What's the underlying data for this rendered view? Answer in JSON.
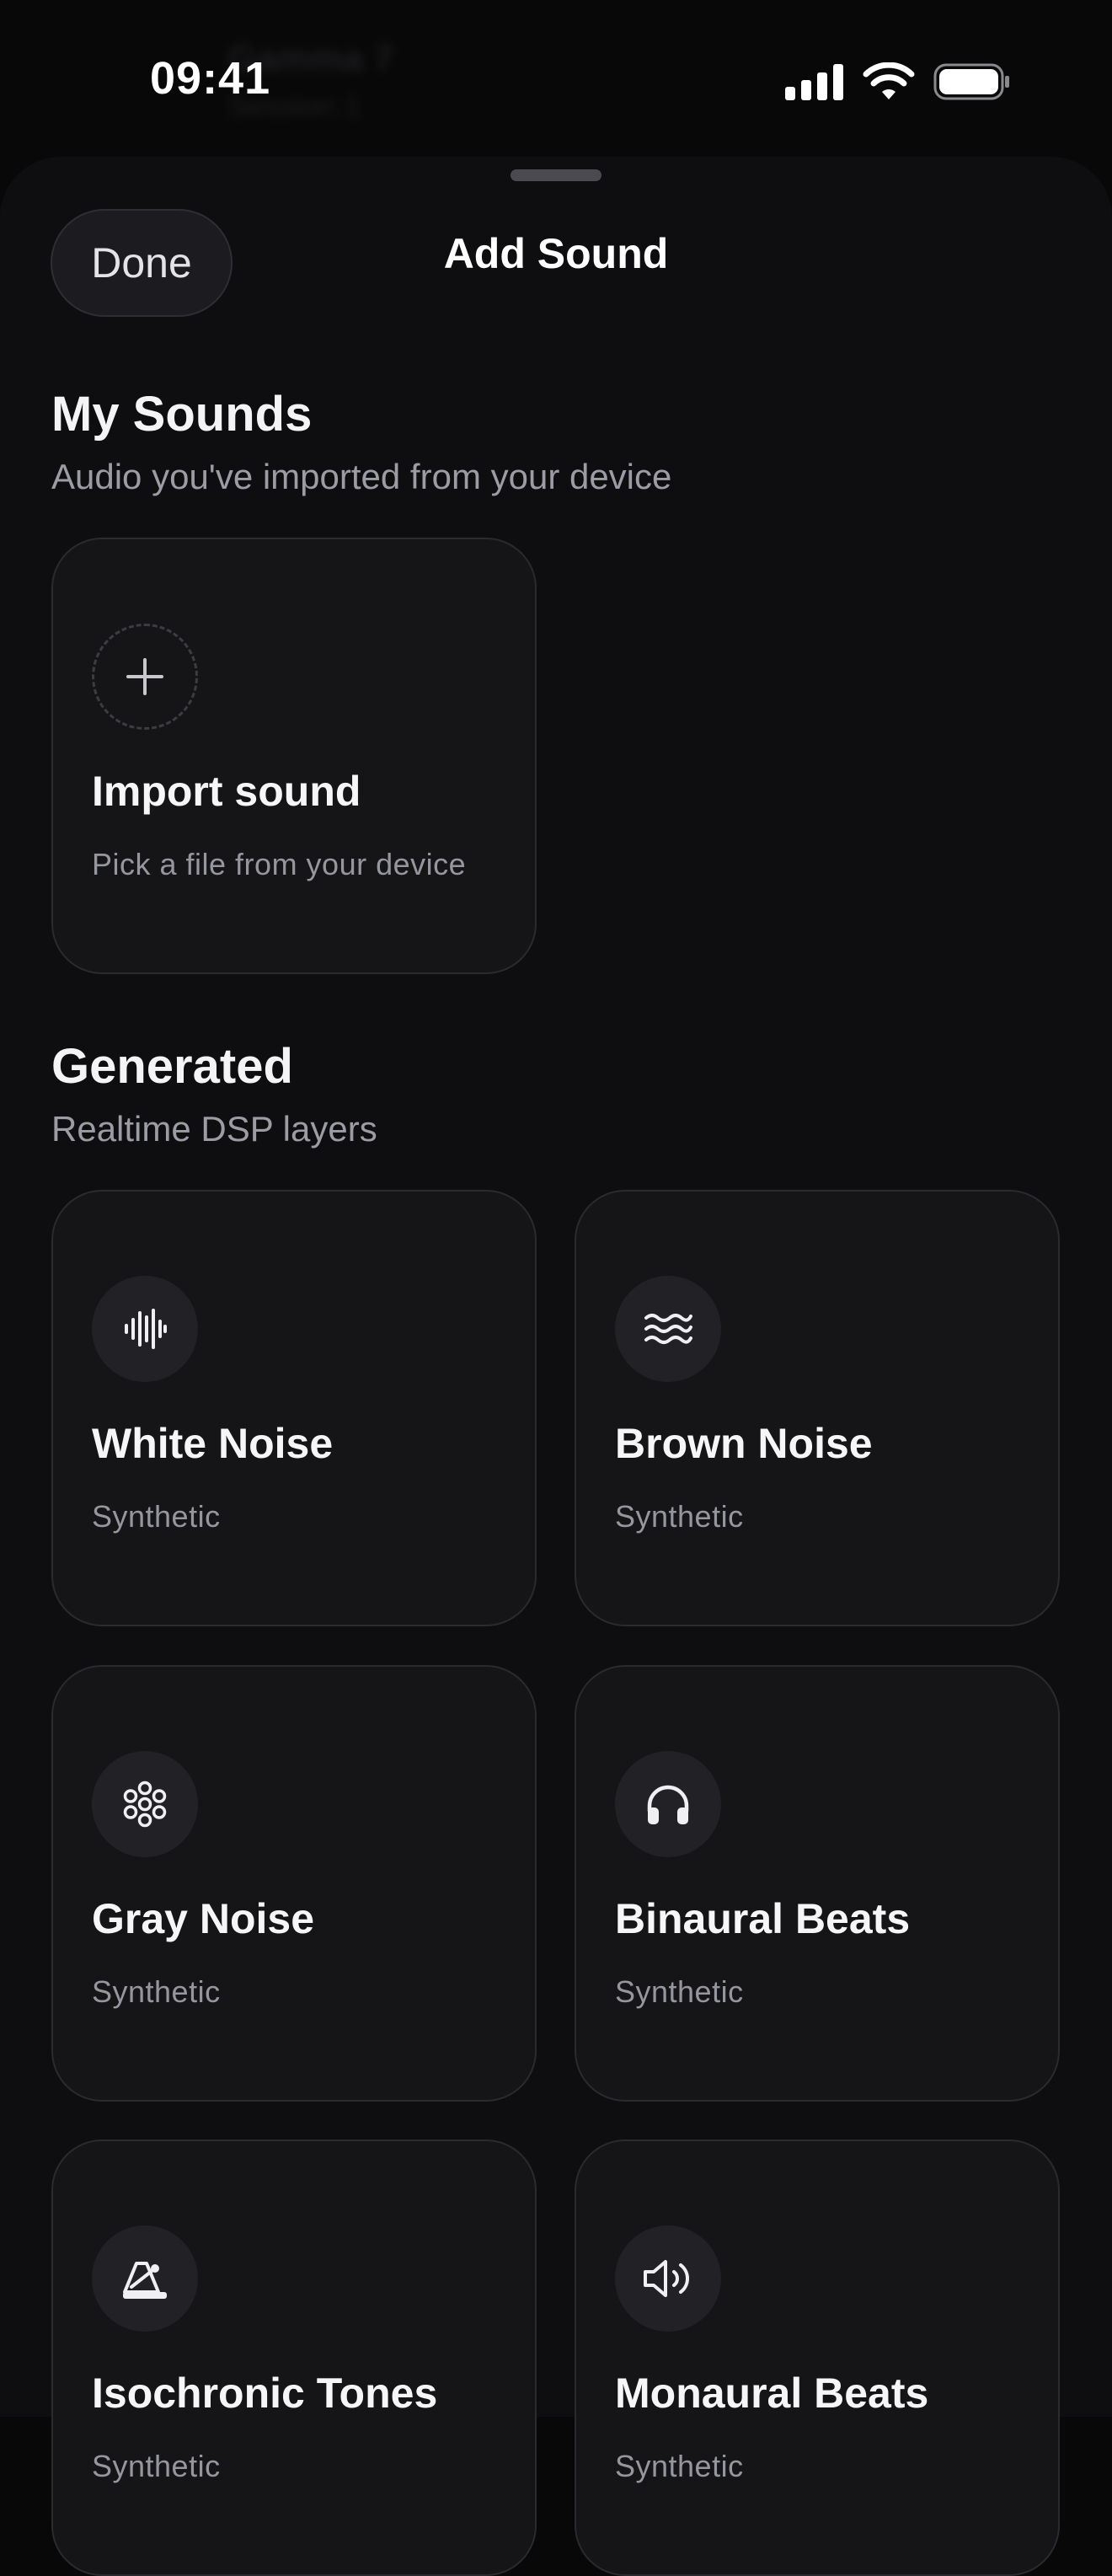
{
  "status_bar": {
    "time": "09:41",
    "behind_text_line1": "Gamma 7",
    "behind_text_line2": "Session 1"
  },
  "sheet": {
    "done_label": "Done",
    "title": "Add Sound"
  },
  "my_sounds": {
    "title": "My Sounds",
    "subtitle": "Audio you've imported from your device",
    "import_card": {
      "title": "Import sound",
      "subtitle": "Pick a file from your device",
      "icon": "plus-icon"
    }
  },
  "generated": {
    "title": "Generated",
    "subtitle": "Realtime DSP layers",
    "items": [
      {
        "label": "White Noise",
        "tag": "Synthetic",
        "icon": "waveform-icon"
      },
      {
        "label": "Brown Noise",
        "tag": "Synthetic",
        "icon": "waves-icon"
      },
      {
        "label": "Gray Noise",
        "tag": "Synthetic",
        "icon": "dots-flower-icon"
      },
      {
        "label": "Binaural Beats",
        "tag": "Synthetic",
        "icon": "headphones-icon"
      },
      {
        "label": "Isochronic Tones",
        "tag": "Synthetic",
        "icon": "metronome-icon"
      },
      {
        "label": "Monaural Beats",
        "tag": "Synthetic",
        "icon": "speaker-icon"
      }
    ]
  },
  "colors": {
    "background": "#080809",
    "sheet": "#0e0e10",
    "card": "#151518",
    "icon_bg": "#222226"
  }
}
